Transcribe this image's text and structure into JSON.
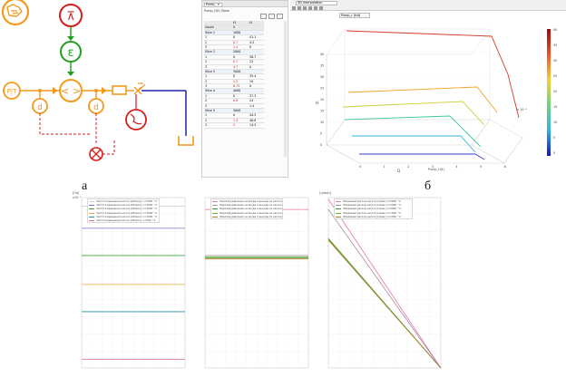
{
  "labels": {
    "a": "а",
    "b": "б"
  },
  "schematic": {
    "orange": "#f29a1e",
    "green": "#1e9e1e",
    "red": "#d81b1b",
    "blue": "#2222aa",
    "controller_top_symbol": "⊼",
    "controller_mid_symbol": "ε",
    "pump_symbol": "< >",
    "pressure_sensor": "P|T",
    "filter_left": "d",
    "filter_right": "d"
  },
  "table_window": {
    "tab_label": "Pump_",
    "close_glyph": "×",
    "title": "Pump_H(t) Table",
    "col_headers": [
      "",
      "t1",
      "t1"
    ],
    "rows": [
      {
        "a": "Count",
        "b": "5",
        "c": "",
        "kind": "hdr"
      },
      {
        "a": "Slice 1",
        "b": "1000",
        "c": "",
        "kind": "slice"
      },
      {
        "a": "1",
        "b": "0",
        "c": "41.1",
        "kind": "row"
      },
      {
        "a": "2",
        "b": "0.7",
        "c": "4.5",
        "kind": "row"
      },
      {
        "a": "3",
        "b": "1.4",
        "c": "0",
        "kind": "row"
      },
      {
        "a": "Slice 2",
        "b": "2000",
        "c": "",
        "kind": "slice"
      },
      {
        "a": "1",
        "b": "0",
        "c": "38.7",
        "kind": "row"
      },
      {
        "a": "2",
        "b": "0.7",
        "c": "22",
        "kind": "row"
      },
      {
        "a": "3",
        "b": "4.7",
        "c": "0",
        "kind": "row"
      },
      {
        "a": "Slice 3",
        "b": "3000",
        "c": "",
        "kind": "slice"
      },
      {
        "a": "1",
        "b": "0",
        "c": "35.4",
        "kind": "row"
      },
      {
        "a": "2",
        "b": "1.2",
        "c": "19",
        "kind": "row"
      },
      {
        "a": "3",
        "b": "6.75",
        "c": "0",
        "kind": "row"
      },
      {
        "a": "Slice 4",
        "b": "4000",
        "c": "",
        "kind": "slice"
      },
      {
        "a": "1",
        "b": "0",
        "c": "37.3",
        "kind": "row"
      },
      {
        "a": "2",
        "b": "0.8",
        "c": "24",
        "kind": "row"
      },
      {
        "a": "3",
        "b": "",
        "c": "1.4",
        "kind": "row"
      },
      {
        "a": "Slice 5",
        "b": "5000",
        "c": "",
        "kind": "slice"
      },
      {
        "a": "1",
        "b": "0",
        "c": "44.5",
        "kind": "row"
      },
      {
        "a": "2",
        "b": "1.3",
        "c": "46.8",
        "kind": "row"
      },
      {
        "a": "3",
        "b": "5",
        "c": "14.5",
        "kind": "row"
      }
    ]
  },
  "plot_window": {
    "tab_label": "3D Interpolation",
    "subtab_label": "Pump_r (trd)",
    "z_ticks": [
      "0",
      "5",
      "10",
      "15",
      "20",
      "25",
      "30",
      "35",
      "40"
    ],
    "x_ticks": [
      "0",
      "1",
      "2",
      "3",
      "4",
      "5",
      "6"
    ],
    "x_label": "Q",
    "y_label": "x 10⁻³",
    "z_label": "H",
    "bottom_label": "Pump_H(t)",
    "colorbar_ticks": [
      "40",
      "35",
      "30",
      "25",
      "20",
      "15",
      "10",
      "5",
      "0"
    ]
  },
  "chart_data": [
    {
      "type": "line",
      "y_unit_label": "[Па]",
      "y_exponent": "x10⁻¹",
      "ylim": [
        0,
        1
      ],
      "x": [
        0,
        1
      ],
      "series": [
        {
          "name": "Частота вращения насоса [об/мин], n=3000 ^2",
          "values": [
            0.95,
            0.95
          ],
          "color": "#cccccc"
        },
        {
          "name": "Частота вращения насоса [об/мин], n=2500 ^2",
          "values": [
            0.82,
            0.82
          ],
          "color": "#7b7bc9"
        },
        {
          "name": "Частота вращения насоса [об/мин], n=2000 ^2",
          "values": [
            0.66,
            0.66
          ],
          "color": "#36a836"
        },
        {
          "name": "Частота вращения насоса [об/мин], n=1500 ^2",
          "values": [
            0.49,
            0.49
          ],
          "color": "#e0b030"
        },
        {
          "name": "Частота вращения насоса [об/мин], n=1000 ^2",
          "values": [
            0.33,
            0.33
          ],
          "color": "#2a8fa8"
        },
        {
          "name": "Частота вращения насоса [об/мин], n=500 ^2",
          "values": [
            0.05,
            0.05
          ],
          "color": "#e06a9a"
        }
      ]
    },
    {
      "type": "line",
      "ylim": [
        0,
        1
      ],
      "x": [
        0,
        1
      ],
      "series": [
        {
          "name": "Перепад давления на входе и выходе из насоса [Па] n=3000 ^2",
          "values": [
            0.93,
            0.93
          ],
          "color": "#e07aa0"
        },
        {
          "name": "Перепад давления на входе и выходе из насоса [Па] n=2500 ^2",
          "values": [
            0.66,
            0.66
          ],
          "color": "#999999"
        },
        {
          "name": "Перепад давления на входе и выходе из насоса [Па] n=2000 ^2",
          "values": [
            0.65,
            0.65
          ],
          "color": "#2e9e2e"
        },
        {
          "name": "Перепад давления на входе и выходе из насоса [Па] n=1500 ^2",
          "values": [
            0.645,
            0.645
          ],
          "color": "#7aaa30"
        },
        {
          "name": "Перепад давления на входе и выходе из насоса [Па] n=1000 ^2",
          "values": [
            0.64,
            0.64
          ],
          "color": "#b07a30"
        }
      ]
    },
    {
      "type": "line",
      "y_unit_label": "[л/мин]",
      "ylim": [
        0,
        1
      ],
      "x": [
        0,
        1
      ],
      "series": [
        {
          "name": "Объемный расход насоса [л/мин] n=3000 ^2",
          "values": [
            0.99,
            0
          ],
          "color": "#e07aa0"
        },
        {
          "name": "Объемный расход насоса [л/мин] n=2500 ^2",
          "values": [
            0.93,
            0
          ],
          "color": "#a78ab0"
        },
        {
          "name": "Объемный расход насоса [л/мин] n=2000 ^2",
          "values": [
            0.76,
            0
          ],
          "color": "#2e9e2e"
        },
        {
          "name": "Объемный расход насоса [л/мин] n=1500 ^2",
          "values": [
            0.755,
            0
          ],
          "color": "#7aaa30"
        },
        {
          "name": "Объемный расход насоса [л/мин] n=1000 ^2",
          "values": [
            0.75,
            0
          ],
          "color": "#b07a30"
        }
      ]
    }
  ]
}
